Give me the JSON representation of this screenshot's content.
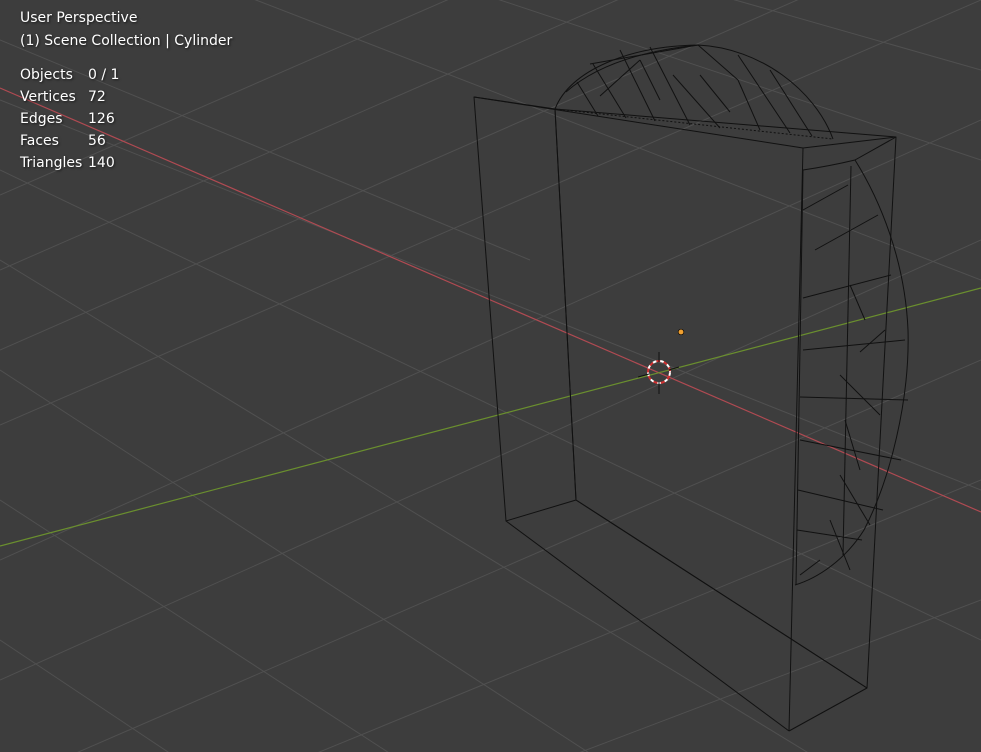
{
  "viewport": {
    "view_name": "User Perspective",
    "context_label": "(1) Scene Collection | Cylinder",
    "stats": [
      {
        "label": "Objects",
        "value": "0 / 1"
      },
      {
        "label": "Vertices",
        "value": "72"
      },
      {
        "label": "Edges",
        "value": "126"
      },
      {
        "label": "Faces",
        "value": "56"
      },
      {
        "label": "Triangles",
        "value": "140"
      }
    ],
    "icons": {
      "cursor": "3d-cursor-icon",
      "origin": "object-origin-icon"
    },
    "colors": {
      "background": "#3d3d3d",
      "grid": "#505050",
      "x_axis": "#b04a52",
      "y_axis": "#6a8f2e",
      "wireframe": "#000000",
      "origin": "#f0a030",
      "cursor_red": "#d03030",
      "cursor_white": "#ffffff"
    }
  }
}
